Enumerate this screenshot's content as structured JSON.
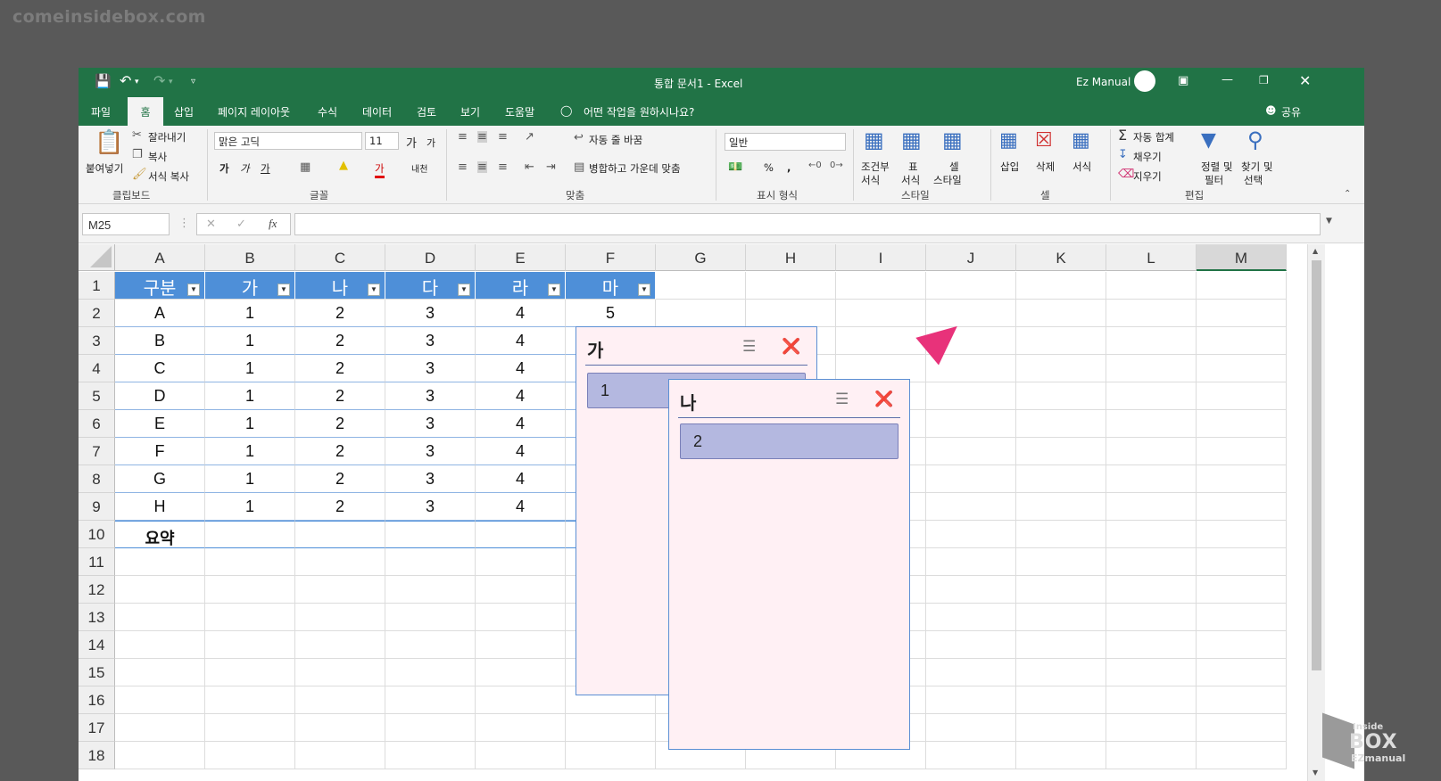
{
  "watermark": "comeinsidebox.com",
  "titlebar": {
    "title": "통합 문서1  -  Excel",
    "user": "Ez Manual",
    "undo_icon": "undo-icon",
    "redo_icon": "redo-icon"
  },
  "tabs": [
    "파일",
    "홈",
    "삽입",
    "페이지 레이아웃",
    "수식",
    "데이터",
    "검토",
    "보기",
    "도움말"
  ],
  "tell_me": "어떤 작업을 원하시나요?",
  "share": "공유",
  "ribbon": {
    "clipboard": {
      "paste": "붙여넣기",
      "cut": "잘라내기",
      "copy": "복사",
      "format_painter": "서식 복사",
      "group": "클립보드"
    },
    "font": {
      "name": "맑은 고딕",
      "size": "11",
      "grow": "가",
      "shrink": "가",
      "bold": "가",
      "italic": "가",
      "underline": "가",
      "font_color": "가",
      "phonetic": "내천",
      "group": "글꼴"
    },
    "alignment": {
      "wrap": "자동 줄 바꿈",
      "merge": "병합하고 가운데 맞춤",
      "group": "맞춤"
    },
    "number": {
      "format": "일반",
      "group": "표시 형식",
      "percent": "%",
      "comma": ","
    },
    "styles": {
      "conditional": "조건부\n서식",
      "conditional_1": "조건부",
      "conditional_2": "서식",
      "table": "표",
      "table_2": "서식",
      "cell": "셀",
      "cell_2": "스타일",
      "group": "스타일"
    },
    "cells": {
      "insert": "삽입",
      "delete": "삭제",
      "format": "서식",
      "group": "셀"
    },
    "editing": {
      "autosum": "자동 합계",
      "fill": "채우기",
      "clear": "지우기",
      "sort_1": "정렬 및",
      "sort_2": "필터",
      "find_1": "찾기 및",
      "find_2": "선택",
      "group": "편집"
    }
  },
  "formula_bar": {
    "name_box": "M25",
    "fx": "fx",
    "formula": ""
  },
  "columns": [
    "A",
    "B",
    "C",
    "D",
    "E",
    "F",
    "G",
    "H",
    "I",
    "J",
    "K",
    "L",
    "M"
  ],
  "rows": [
    "1",
    "2",
    "3",
    "4",
    "5",
    "6",
    "7",
    "8",
    "9",
    "10",
    "11",
    "12",
    "13",
    "14",
    "15",
    "16",
    "17",
    "18"
  ],
  "table": {
    "headers": [
      "구분",
      "가",
      "나",
      "다",
      "라",
      "마"
    ],
    "data": [
      [
        "A",
        "1",
        "2",
        "3",
        "4",
        "5"
      ],
      [
        "B",
        "1",
        "2",
        "3",
        "4",
        ""
      ],
      [
        "C",
        "1",
        "2",
        "3",
        "4",
        ""
      ],
      [
        "D",
        "1",
        "2",
        "3",
        "4",
        ""
      ],
      [
        "E",
        "1",
        "2",
        "3",
        "4",
        ""
      ],
      [
        "F",
        "1",
        "2",
        "3",
        "4",
        ""
      ],
      [
        "G",
        "1",
        "2",
        "3",
        "4",
        ""
      ],
      [
        "H",
        "1",
        "2",
        "3",
        "4",
        ""
      ]
    ],
    "summary_label": "요약",
    "header_color": "#4e8fd8"
  },
  "slicers": [
    {
      "title": "가",
      "items": [
        "1"
      ]
    },
    {
      "title": "나",
      "items": [
        "2"
      ]
    }
  ],
  "colors": {
    "excel_green": "#217346",
    "slicer_bg": "#fff0f4",
    "slicer_item": "#b4b8e0",
    "arrow": "#e8327a"
  },
  "logo": {
    "text_1": "Inside",
    "text_2": "BOX",
    "text_3": "EZmanual"
  }
}
